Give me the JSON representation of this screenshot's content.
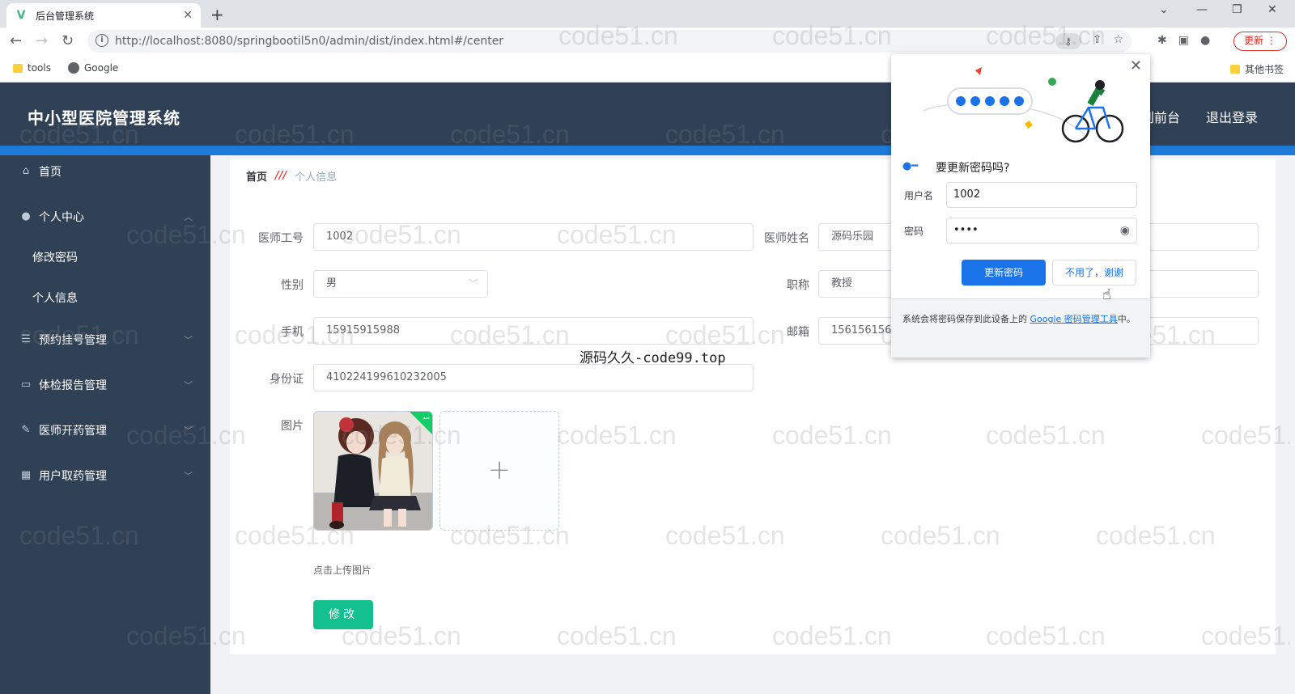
{
  "browser": {
    "tab_title": "后台管理系统",
    "url": "http://localhost:8080/springbootil5n0/admin/dist/index.html#/center",
    "update_label": "更新",
    "bookmarks": [
      "tools",
      "Google"
    ],
    "other_bookmarks": "其他书签"
  },
  "header": {
    "title": "中小型医院管理系统",
    "front_link": "到前台",
    "logout": "退出登录"
  },
  "sidebar": {
    "items": [
      {
        "label": "首页",
        "icon": "home-icon"
      },
      {
        "label": "个人中心",
        "icon": "user-icon"
      },
      {
        "label": "修改密码"
      },
      {
        "label": "个人信息"
      },
      {
        "label": "预约挂号管理",
        "icon": "list-icon"
      },
      {
        "label": "体检报告管理",
        "icon": "chat-icon"
      },
      {
        "label": "医师开药管理",
        "icon": "pen-icon"
      },
      {
        "label": "用户取药管理",
        "icon": "chart-icon"
      }
    ]
  },
  "breadcrumb": {
    "home": "首页",
    "current": "个人信息"
  },
  "form": {
    "doctor_id_label": "医师工号",
    "doctor_id": "1002",
    "doctor_name_label": "医师姓名",
    "doctor_name": "源码乐园",
    "gender_label": "性别",
    "gender": "男",
    "title_label": "职称",
    "title": "教授",
    "phone_label": "手机",
    "phone": "15915915988",
    "email_label": "邮箱",
    "email": "1561561561",
    "id_card_label": "身份证",
    "id_card": "410224199610232005",
    "image_label": "图片",
    "upload_tip": "点击上传图片",
    "submit": "修改"
  },
  "overlay_text": "源码久久-code99.top",
  "watermark": "code51.cn",
  "password_popup": {
    "title": "要更新密码吗?",
    "username_label": "用户名",
    "username": "1002",
    "password_label": "密码",
    "password_mask": "••••",
    "update_button": "更新密码",
    "cancel_button": "不用了，谢谢",
    "footer_text": "系统会将密码保存到此设备上的 ",
    "footer_link": "Google 密码管理工具",
    "footer_end": "中。"
  },
  "colors": {
    "header_bg": "#304156",
    "accent_band": "#1e7ad8",
    "submit_green": "#13c08e",
    "chrome_blue": "#1a73e8"
  }
}
